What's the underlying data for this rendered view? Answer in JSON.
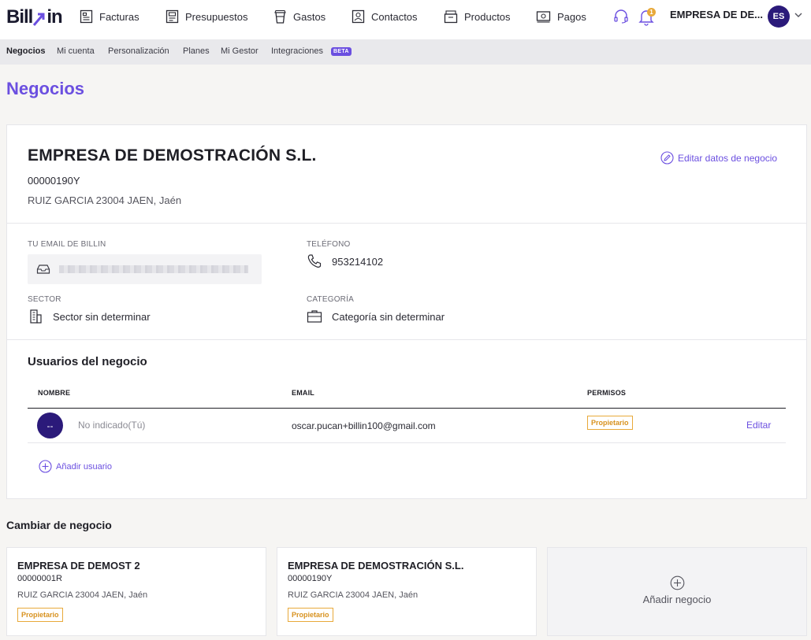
{
  "app": {
    "logo_text_1": "Bill",
    "logo_text_2": "in"
  },
  "topnav": {
    "items": [
      {
        "label": "Facturas",
        "icon": "invoice-icon"
      },
      {
        "label": "Presupuestos",
        "icon": "quote-icon"
      },
      {
        "label": "Gastos",
        "icon": "expenses-cup-icon"
      },
      {
        "label": "Contactos",
        "icon": "contacts-icon"
      },
      {
        "label": "Productos",
        "icon": "products-box-icon"
      },
      {
        "label": "Pagos",
        "icon": "payments-icon"
      }
    ],
    "notification_count": "1",
    "company_short": "EMPRESA DE DE...",
    "avatar_initials": "ES"
  },
  "subnav": {
    "items": [
      "Negocios",
      "Mi cuenta",
      "Personalización",
      "Planes",
      "Mi Gestor",
      "Integraciones"
    ],
    "active": "Negocios",
    "beta_label": "BETA"
  },
  "page": {
    "title": "Negocios"
  },
  "business": {
    "name": "EMPRESA DE DEMOSTRACIÓN S.L.",
    "cif": "00000190Y",
    "address": "RUIZ GARCIA 23004 JAEN, Jaén",
    "edit_label": "Editar datos de negocio",
    "email_label": "TU EMAIL DE BILLIN",
    "phone_label": "TELÉFONO",
    "phone": "953214102",
    "sector_label": "SECTOR",
    "sector": "Sector sin determinar",
    "category_label": "CATEGORÍA",
    "category": "Categoría sin determinar"
  },
  "users": {
    "title": "Usuarios del negocio",
    "columns": [
      "NOMBRE",
      "EMAIL",
      "PERMISOS"
    ],
    "rows": [
      {
        "avatar": "--",
        "name": "No indicado(Tú)",
        "email": "oscar.pucan+billin100@gmail.com",
        "permission": "Propietario",
        "action": "Editar"
      }
    ],
    "add_label": "Añadir usuario"
  },
  "switch": {
    "title": "Cambiar de negocio",
    "businesses": [
      {
        "name": "EMPRESA DE DEMOST 2",
        "cif": "00000001R",
        "address": "RUIZ GARCIA 23004 JAEN, Jaén",
        "role": "Propietario"
      },
      {
        "name": "EMPRESA DE DEMOSTRACIÓN S.L.",
        "cif": "00000190Y",
        "address": "RUIZ GARCIA 23004 JAEN, Jaén",
        "role": "Propietario"
      }
    ],
    "add_label": "Añadir negocio"
  },
  "colors": {
    "accent": "#6b4fe0",
    "avatar_bg": "#2b1a7a",
    "badge": "#e8a93a"
  }
}
